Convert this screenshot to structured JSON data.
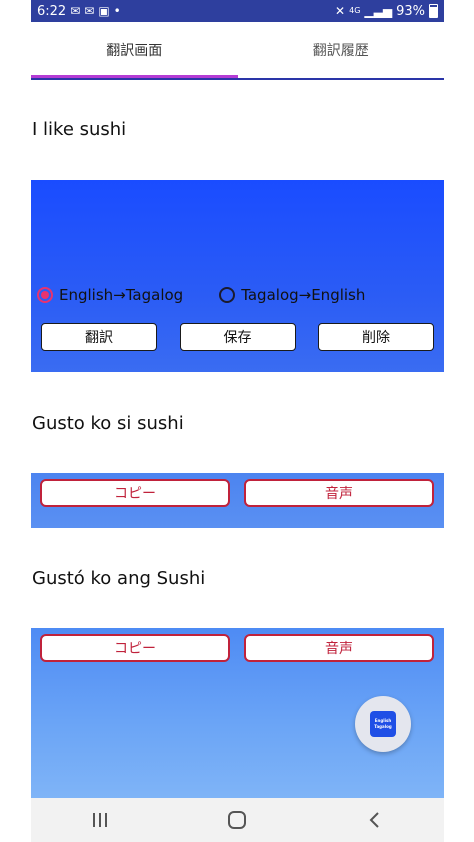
{
  "status": {
    "time": "6:22",
    "network": "4G",
    "battery": "93%"
  },
  "tabs": [
    {
      "label": "翻訳画面"
    },
    {
      "label": "翻訳履歴"
    }
  ],
  "input_text": "I like sushi",
  "direction": {
    "option1": "English→Tagalog",
    "option2": "Tagalog→English",
    "selected": "English→Tagalog"
  },
  "actions": {
    "translate": "翻訳",
    "save": "保存",
    "delete": "削除"
  },
  "results": [
    {
      "text": "Gusto ko si sushi",
      "copy_label": "コピー",
      "voice_label": "音声"
    },
    {
      "text": "Gustó ko ang Sushi",
      "copy_label": "コピー",
      "voice_label": "音声"
    }
  ],
  "fab": {
    "line1": "English",
    "line2": "Tagalog"
  },
  "colors": {
    "accent": "#b43bd4",
    "panel_blue": "#1a4cff",
    "button_red": "#c0223b",
    "status_bar": "#2e3f9e"
  }
}
